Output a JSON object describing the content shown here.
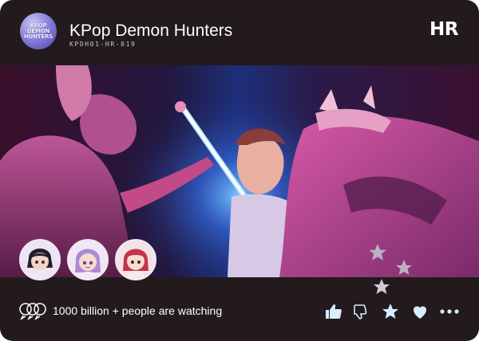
{
  "header": {
    "logo_lines": [
      "KPOP",
      "DEMON",
      "HUNTERS"
    ],
    "title": "KPop Demon Hunters",
    "code": "KPDH01-HR-019",
    "rarity": "HR"
  },
  "footer": {
    "watching_text": "1000 billion + people are watching",
    "actions": [
      {
        "icon": "thumbs-up-icon"
      },
      {
        "icon": "thumbs-down-icon"
      },
      {
        "icon": "star-icon"
      },
      {
        "icon": "heart-icon"
      },
      {
        "icon": "more-icon"
      }
    ]
  },
  "avatars": [
    {
      "icon": "chibi-avatar-dark-hair-icon"
    },
    {
      "icon": "chibi-avatar-purple-braid-icon"
    },
    {
      "icon": "chibi-avatar-red-hair-icon"
    }
  ],
  "colors": {
    "card_background": "#221a1c",
    "accent_pink": "#e04a9a",
    "accent_blue": "#5fa8ff",
    "icon_fill": "#d9ecff"
  }
}
